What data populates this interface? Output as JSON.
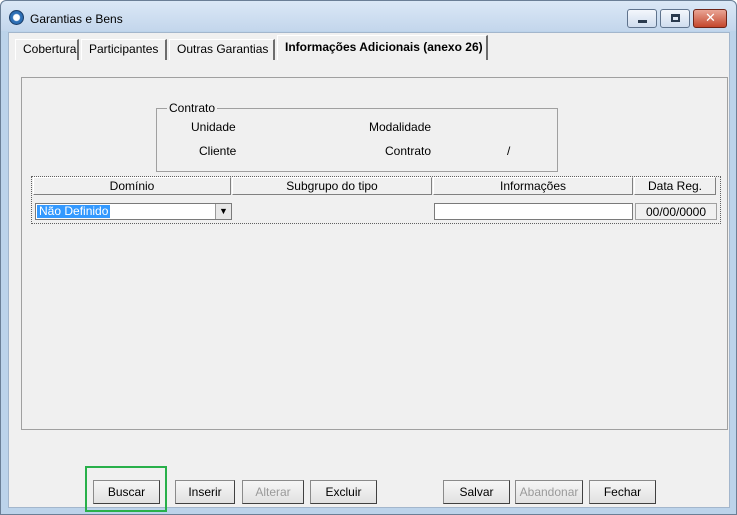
{
  "window": {
    "title": "Garantias e Bens",
    "minimize_icon": "minimize-icon",
    "maximize_icon": "maximize-icon",
    "close_icon": "close-icon",
    "close_glyph": "✕"
  },
  "tabs": [
    {
      "label": "Cobertura"
    },
    {
      "label": "Participantes"
    },
    {
      "label": "Outras Garantias"
    },
    {
      "label": "Informações Adicionais (anexo 26)",
      "active": true
    }
  ],
  "contract": {
    "legend": "Contrato",
    "unidade_label": "Unidade",
    "modalidade_label": "Modalidade",
    "cliente_label": "Cliente",
    "contrato_label": "Contrato",
    "separator": "/"
  },
  "grid": {
    "columns": [
      "Domínio",
      "Subgrupo do tipo",
      "Informações",
      "Data Reg."
    ],
    "row": {
      "dominio": "Não Definido",
      "dropdown_arrow": "▼",
      "informacoes": "",
      "data_reg": "00/00/0000"
    }
  },
  "buttons": {
    "buscar": "Buscar",
    "inserir": "Inserir",
    "alterar": "Alterar",
    "excluir": "Excluir",
    "salvar": "Salvar",
    "abandonar": "Abandonar",
    "fechar": "Fechar"
  },
  "colors": {
    "highlight": "#28b04a",
    "selection": "#3399ff"
  }
}
